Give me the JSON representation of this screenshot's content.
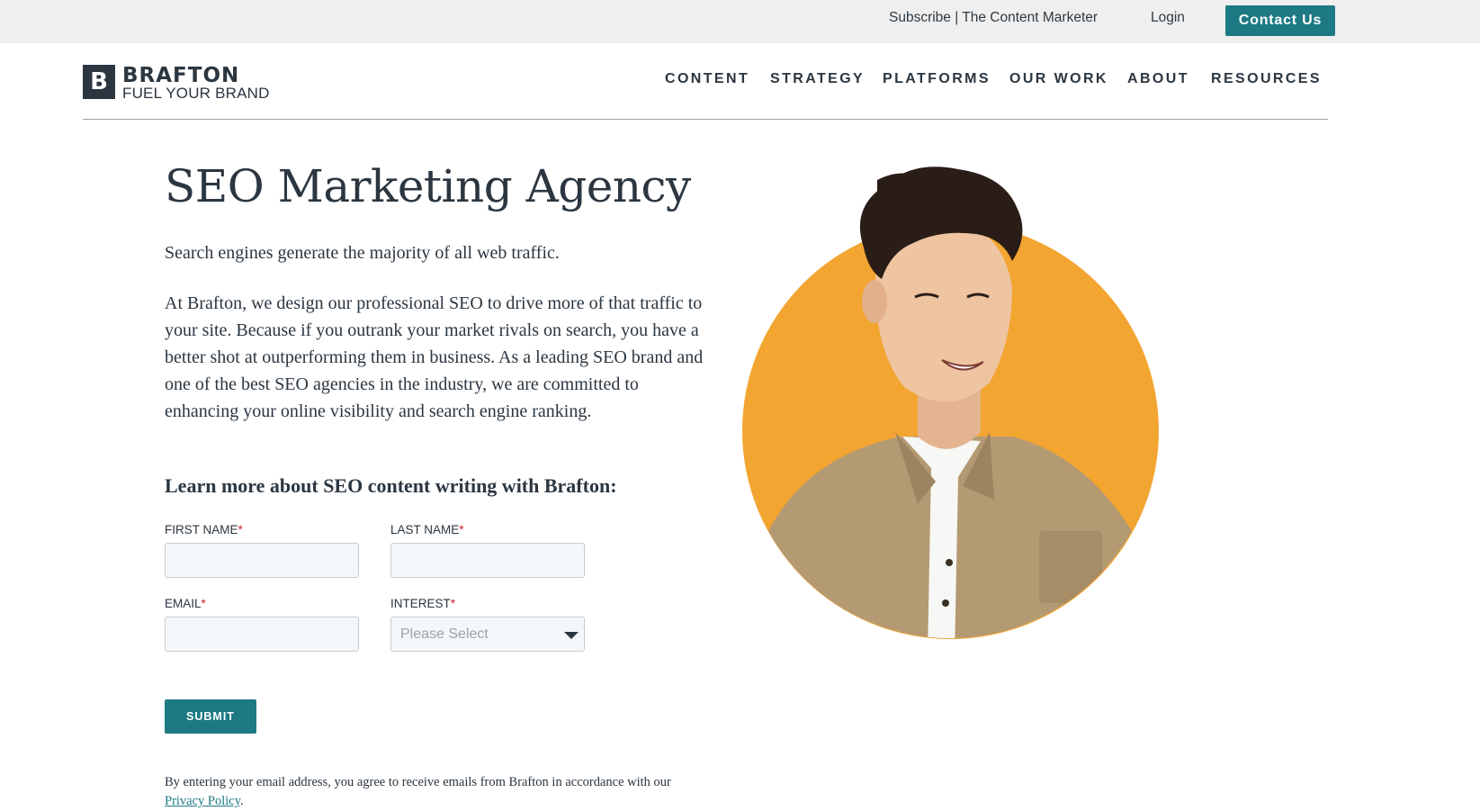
{
  "topbar": {
    "subscribe_label": "Subscribe | The Content Marketer",
    "login_label": "Login",
    "contact_label": "Contact Us"
  },
  "brand": {
    "logo_letter": "B",
    "name": "BRAFTON",
    "tagline": "FUEL YOUR BRAND"
  },
  "nav": {
    "items": [
      {
        "label": "CONTENT"
      },
      {
        "label": "STRATEGY"
      },
      {
        "label": "PLATFORMS"
      },
      {
        "label": "OUR WORK"
      },
      {
        "label": "ABOUT"
      },
      {
        "label": "RESOURCES"
      }
    ]
  },
  "hero": {
    "title": "SEO Marketing Agency",
    "intro": "Search engines generate the majority of all web traffic.",
    "body": "At Brafton, we design our professional SEO to drive more of that traffic to your site. Because if you outrank your market rivals on search, you have a better shot at outperforming them in business. As a leading SEO brand and one of the best SEO agencies in the industry, we are committed to enhancing your online visibility and search engine ranking.",
    "image_accent_color": "#f3a531"
  },
  "form": {
    "heading": "Learn more about SEO content writing with Brafton:",
    "first_name_label": "FIRST NAME",
    "last_name_label": "LAST NAME",
    "email_label": "EMAIL",
    "interest_label": "INTEREST",
    "required_marker": "*",
    "first_name_value": "",
    "last_name_value": "",
    "email_value": "",
    "interest_placeholder": "Please Select",
    "submit_label": "SUBMIT",
    "disclaimer_text": "By entering your email address, you agree to receive emails from Brafton in accordance with our ",
    "privacy_link": "Privacy Policy",
    "disclaimer_end": "."
  },
  "colors": {
    "accent": "#1d7a84",
    "text": "#2b3640",
    "topbar_bg": "#efefef"
  }
}
